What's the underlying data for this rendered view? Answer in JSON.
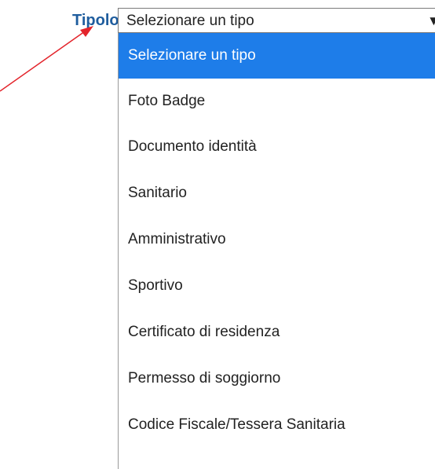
{
  "form": {
    "field_label": "Tipologia:",
    "select": {
      "selected_value": "Selezionare un tipo",
      "arrow_glyph": "▼"
    },
    "options": [
      "Selezionare un tipo",
      "Foto Badge",
      "Documento identità",
      "Sanitario",
      "Amministrativo",
      "Sportivo",
      "Certificato di residenza",
      "Permesso di soggiorno",
      "Codice Fiscale/Tessera Sanitaria"
    ],
    "highlighted_option_index": 0
  },
  "colors": {
    "label": "#1f5d9e",
    "highlight": "#1e7de9",
    "annotation_arrow": "#e3242b"
  }
}
